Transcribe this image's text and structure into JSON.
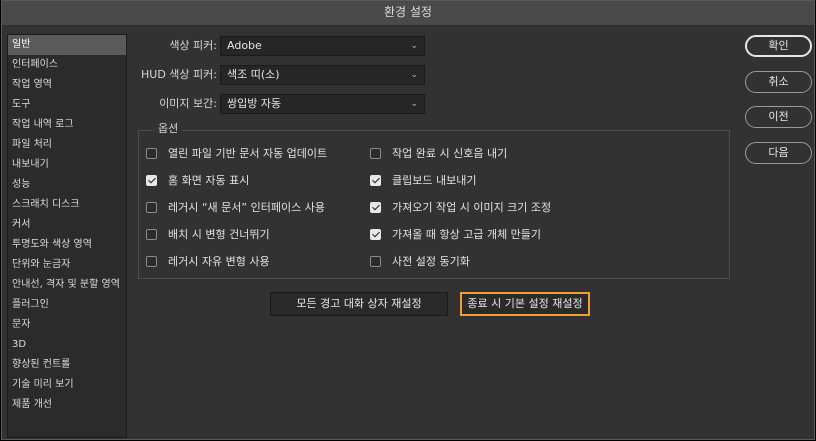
{
  "window": {
    "title": "환경 설정"
  },
  "sidebar": {
    "items": [
      {
        "label": "일반",
        "active": true
      },
      {
        "label": "인터페이스"
      },
      {
        "label": "작업 영역"
      },
      {
        "label": "도구"
      },
      {
        "label": "작업 내역 로그"
      },
      {
        "label": "파일 처리"
      },
      {
        "label": "내보내기"
      },
      {
        "label": "성능"
      },
      {
        "label": "스크래치 디스크"
      },
      {
        "label": "커서"
      },
      {
        "label": "투명도와 색상 영역"
      },
      {
        "label": "단위와 눈금자"
      },
      {
        "label": "안내선, 격자 및 분할 영역"
      },
      {
        "label": "플러그인"
      },
      {
        "label": "문자"
      },
      {
        "label": "3D"
      },
      {
        "label": "향상된 컨트롤"
      },
      {
        "label": "기술 미리 보기"
      },
      {
        "label": "제품 개선"
      }
    ]
  },
  "fields": {
    "color_picker": {
      "label": "색상 피커:",
      "value": "Adobe"
    },
    "hud_color_picker": {
      "label": "HUD 색상 피커:",
      "value": "색조 띠(소)"
    },
    "interpolation": {
      "label": "이미지 보간:",
      "value": "쌍입방 자동"
    }
  },
  "options": {
    "legend": "옵션",
    "left": [
      {
        "label": "열린 파일 기반 문서 자동 업데이트",
        "checked": false
      },
      {
        "label": "홈 화면 자동 표시",
        "checked": true
      },
      {
        "label": "레거시 “새 문서” 인터페이스 사용",
        "checked": false
      },
      {
        "label": "배치 시 변형 건너뛰기",
        "checked": false
      },
      {
        "label": "레거시 자유 변형 사용",
        "checked": false
      }
    ],
    "right": [
      {
        "label": "작업 완료 시 신호음 내기",
        "checked": false
      },
      {
        "label": "클립보드 내보내기",
        "checked": true
      },
      {
        "label": "가져오기 작업 시 이미지 크기 조정",
        "checked": true
      },
      {
        "label": "가져올 때 항상 고급 개체 만들기",
        "checked": true
      },
      {
        "label": "사전 설정 동기화",
        "checked": false
      }
    ]
  },
  "buttons": {
    "reset_warnings": "모든 경고 대화 상자 재설정",
    "reset_on_quit": "종료 시 기본 설정 재설정",
    "ok": "확인",
    "cancel": "취소",
    "prev": "이전",
    "next": "다음"
  },
  "icons": {
    "dropdown": "chevron-down-icon",
    "check": "checkmark-icon"
  },
  "colors": {
    "focus_ring": "#f0a030",
    "window_bg": "#323232",
    "active_item": "#5a5a5a"
  }
}
